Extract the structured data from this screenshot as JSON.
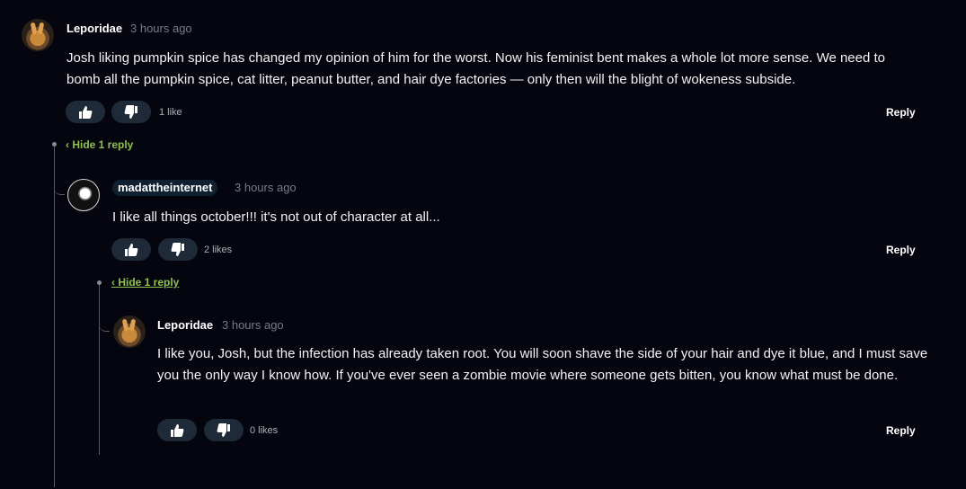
{
  "comments": [
    {
      "user": "Leporidae",
      "time": "3 hours ago",
      "text": "Josh liking pumpkin spice has changed my opinion of him for the worst. Now his feminist bent makes a whole lot more sense. We need to bomb all the pumpkin spice, cat litter, peanut butter, and hair dye factories — only then will the blight of wokeness subside.",
      "likes": "1 like",
      "reply": "Reply",
      "toggle": "‹ Hide 1 reply"
    },
    {
      "user": "madattheinternet",
      "time": "3 hours ago",
      "text": "I like all things october!!! it's not out of character at all...",
      "likes": "2 likes",
      "reply": "Reply",
      "toggle": "‹ Hide 1 reply"
    },
    {
      "user": "Leporidae",
      "time": "3 hours ago",
      "text": "I like you, Josh, but the infection has already taken root. You will soon shave the side of your hair and dye it blue, and I must save you the only way I know how. If you've ever seen a zombie movie where someone gets bitten, you know what must be done.",
      "likes": "0 likes",
      "reply": "Reply"
    }
  ],
  "icons": {
    "upvote": "thumbs-up-icon",
    "downvote": "thumbs-down-icon"
  },
  "colors": {
    "background": "#05050f",
    "accent_green": "#8ec14f",
    "vote_button": "#1e2a38"
  }
}
